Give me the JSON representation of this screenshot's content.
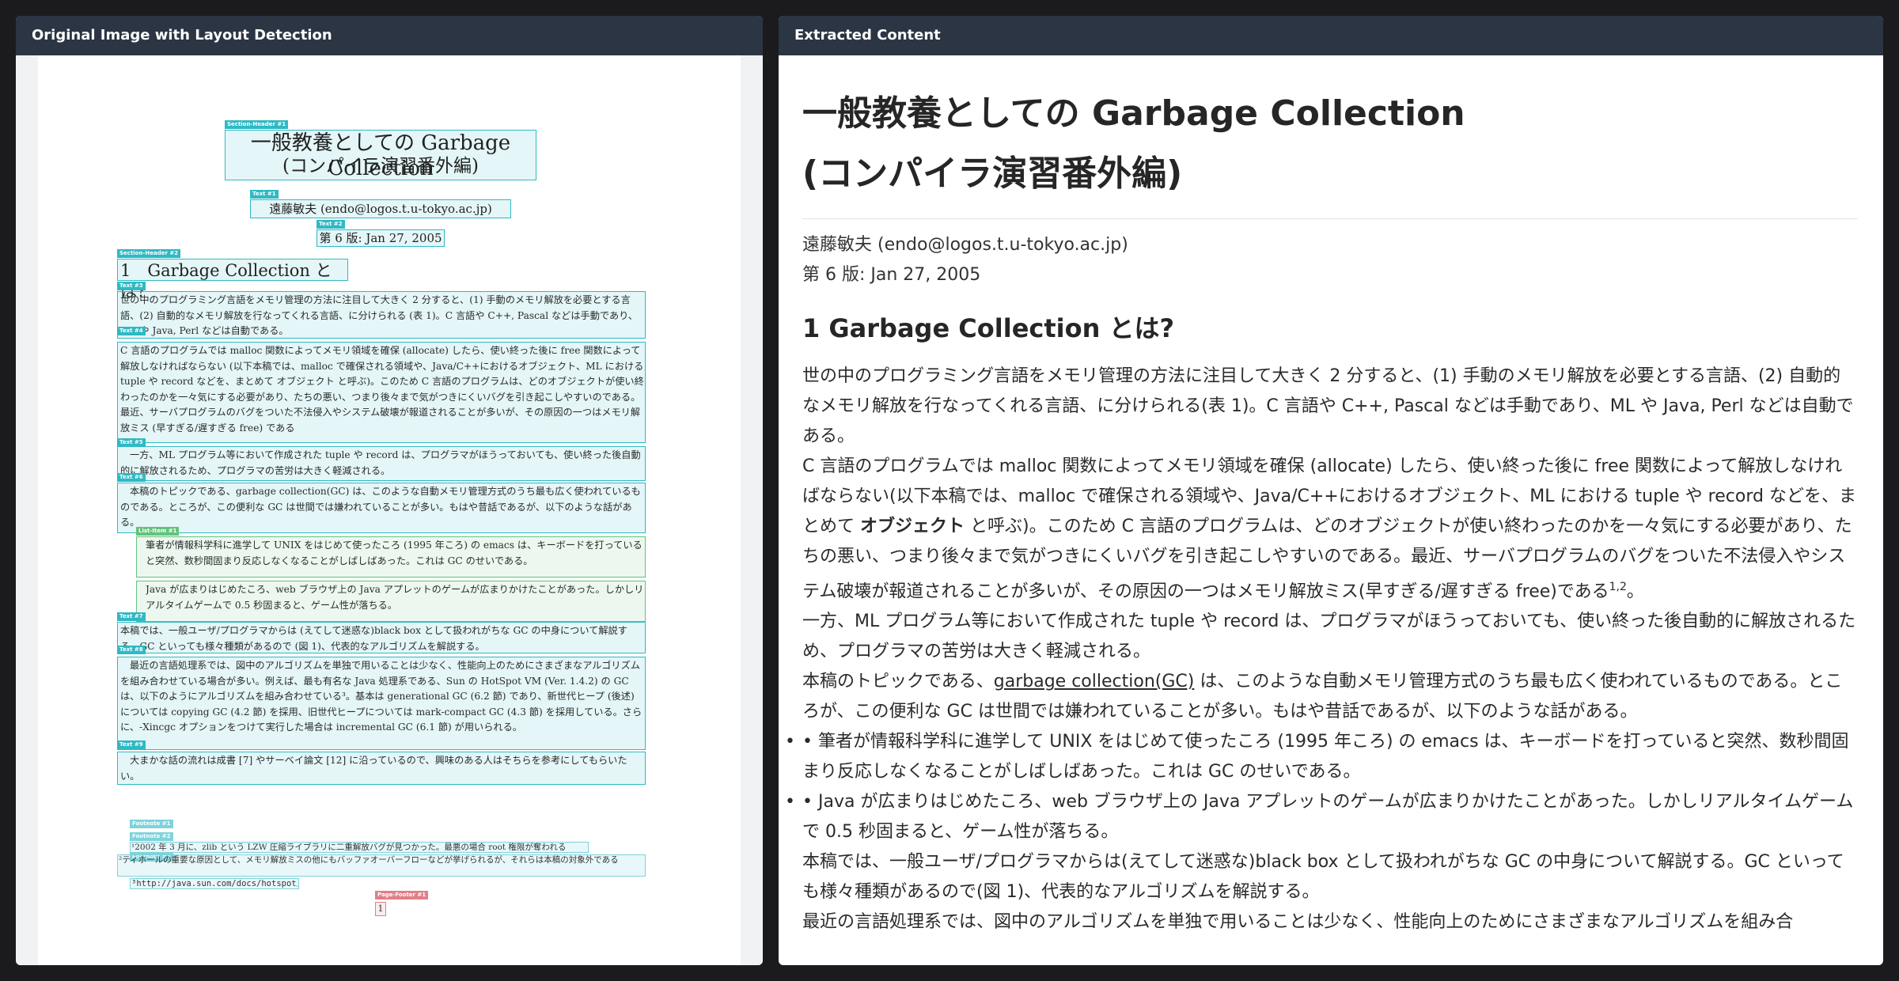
{
  "left_panel": {
    "header": "Original Image with Layout Detection",
    "page": {
      "title_line1": "一般教養としての Garbage Collection",
      "title_line2": "(コンパイラ演習番外編)",
      "author": "遠藤敏夫 (endo@logos.t.u-tokyo.ac.jp)",
      "version": "第 6 版: Jan 27, 2005",
      "section_heading": "1　Garbage Collection とは?",
      "paragraphs": [
        "世の中のプログラミング言語をメモリ管理の方法に注目して大きく 2 分すると、(1) 手動のメモリ解放を必要とする言語、(2) 自動的なメモリ解放を行なってくれる言語、に分けられる (表 1)。C 言語や C++, Pascal などは手動であり、ML や Java, Perl などは自動である。",
        "C 言語のプログラムでは malloc 関数によってメモリ領域を確保 (allocate) したら、使い終った後に free 関数によって解放しなければならない (以下本稿では、malloc で確保される領域や、Java/C++におけるオブジェクト、ML における tuple や record などを、まとめて オブジェクト と呼ぶ)。このため C 言語のプログラムは、どのオブジェクトが使い終わったのかを一々気にする必要があり、たちの悪い、つまり後々まで気がつきにくいバグを引き起こしやすいのである。最近、サーバプログラムのバグをついた不法侵入やシステム破壊が報道されることが多いが、その原因の一つはメモリ解放ミス (早すぎる/遅すぎる free) である",
        "一方、ML プログラム等において作成された tuple や record は、プログラマがほうっておいても、使い終った後自動的に解放されるため、プログラマの苦労は大きく軽減される。",
        "本稿のトピックである、garbage collection(GC) は、このような自動メモリ管理方式のうち最も広く使われているものである。ところが、この便利な GC は世間では嫌われていることが多い。もはや昔話であるが、以下のような話がある。",
        "本稿では、一般ユーザ/プログラマからは (えてして迷惑な)black box として扱われがちな GC の中身について解説する。GC といっても様々種類があるので (図 1)、代表的なアルゴリズムを解説する。",
        "最近の言語処理系では、図中のアルゴリズムを単独で用いることは少なく、性能向上のためにさまざまなアルゴリズムを組み合わせている場合が多い。例えば、最も有名な Java 処理系である、Sun の HotSpot VM (Ver. 1.4.2) の GC は、以下のようにアルゴリズムを組み合わせている³。基本は generational GC (6.2 節) であり、新世代ヒープ (後述) については copying GC (4.2 節) を採用、旧世代ヒープについては mark-compact GC (4.3 節) を採用している。さらに、-Xincgc オプションをつけて実行した場合は incremental GC (6.1 節) が用いられる。",
        "大まかな話の流れは成書 [7] やサーベイ論文 [12] に沿っているので、興味のある人はそちらを参考にしてもらいたい。"
      ],
      "bullets": [
        "筆者が情報科学科に進学して UNIX をはじめて使ったころ (1995 年ころ) の emacs は、キーボードを打っていると突然、数秒間固まり反応しなくなることがしばしばあった。これは GC のせいである。",
        "Java が広まりはじめたころ、web ブラウザ上の Java アプレットのゲームが広まりかけたことがあった。しかしリアルタイムゲームで 0.5 秒固まると、ゲーム性が落ちる。"
      ],
      "footnotes": [
        "¹2002 年 3 月に、zlib という LZW 圧縮ライブラリに二重解放バグが見つかった。最悪の場合 root 権限が奪われる",
        "²ティホールの重要な原因として、メモリ解放ミスの他にもバッファオーバーフローなどが挙げられるが、それらは本稿の対象外である",
        "³http://java.sun.com/docs/hotspot/"
      ],
      "page_number": "1",
      "tags": {
        "section_header_1": "Section-Header #1",
        "text_1": "Text #1",
        "text_2": "Text #2",
        "section_header_2": "Section-Header #2",
        "text_3": "Text #3",
        "text_4": "Text #4",
        "text_5": "Text #5",
        "text_6": "Text #6",
        "list_item_1": "List-Item #1",
        "text_7": "Text #7",
        "text_8": "Text #8",
        "text_9": "Text #9",
        "footnote_1": "Footnote #1",
        "footnote_2": "Footnote #2",
        "footnote_3": "Footnote #3",
        "page_footer_1": "Page-Footer #1"
      }
    }
  },
  "right_panel": {
    "header": "Extracted Content",
    "title_line1": "一般教養としての Garbage Collection",
    "title_line2": "(コンパイラ演習番外編)",
    "author": "遠藤敏夫 (endo@logos.t.u-tokyo.ac.jp)",
    "version": "第 6 版: Jan 27, 2005",
    "section_heading": "1 Garbage Collection とは?",
    "p1": "世の中のプログラミング言語をメモリ管理の方法に注目して大きく 2 分すると、(1) 手動のメモリ解放を必要とする言語、(2) 自動的なメモリ解放を行なってくれる言語、に分けられる(表 1)。C 言語や C++, Pascal などは手動であり、ML や Java, Perl などは自動である。",
    "p2_before": "C 言語のプログラムでは malloc 関数によってメモリ領域を確保 (allocate) したら、使い終った後に free 関数によって解放しなければならない(以下本稿では、malloc で確保される領域や、Java/C++におけるオブジェクト、ML における tuple や record などを、まとめて ",
    "p2_bold": "オブジェクト",
    "p2_after": " と呼ぶ)。このため C 言語のプログラムは、どのオブジェクトが使い終わったのかを一々気にする必要があり、たちの悪い、つまり後々まで気がつきにくいバグを引き起こしやすいのである。最近、サーバプログラムのバグをついた不法侵入やシステム破壊が報道されることが多いが、その原因の一つはメモリ解放ミス(早すぎる/遅すぎる free)である",
    "p2_sup": "1,2",
    "p2_end": "。",
    "p3": "一方、ML プログラム等において作成された tuple や record は、プログラマがほうっておいても、使い終った後自動的に解放されるため、プログラマの苦労は大きく軽減される。",
    "p4_before": "本稿のトピックである、",
    "p4_link": "garbage collection(GC)",
    "p4_after": " は、このような自動メモリ管理方式のうち最も広く使われているものである。ところが、この便利な GC は世間では嫌われていることが多い。もはや昔話であるが、以下のような話がある。",
    "bullet_dot": "•",
    "bullet1": "• 筆者が情報科学科に進学して UNIX をはじめて使ったころ (1995 年ころ) の emacs は、キーボードを打っていると突然、数秒間固まり反応しなくなることがしばしばあった。これは GC のせいである。",
    "bullet2": "• Java が広まりはじめたころ、web ブラウザ上の Java アプレットのゲームが広まりかけたことがあった。しかしリアルタイムゲームで 0.5 秒固まると、ゲーム性が落ちる。",
    "p5": "本稿では、一般ユーザ/プログラマからは(えてして迷惑な)black box として扱われがちな GC の中身について解説する。GC といっても様々種類があるので(図 1)、代表的なアルゴリズムを解説する。",
    "p6": "最近の言語処理系では、図中のアルゴリズムを単独で用いることは少なく、性能向上のためにさまざまなアルゴリズムを組み合"
  }
}
